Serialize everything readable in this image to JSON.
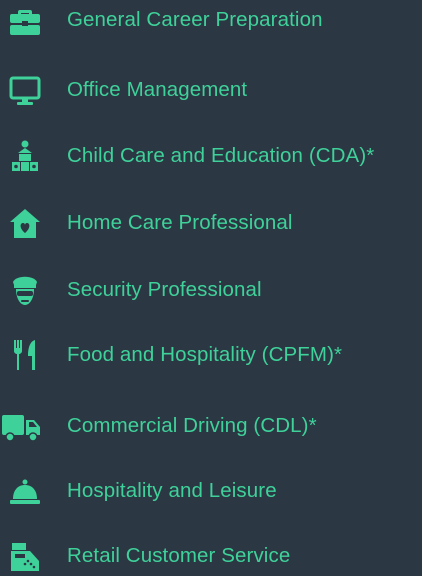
{
  "accent_color": "#3fd19a",
  "background_color": "#2b3843",
  "programs": [
    {
      "label": "General Career Preparation",
      "icon": "briefcase-icon"
    },
    {
      "label": "Office Management",
      "icon": "desktop-monitor-icon"
    },
    {
      "label": "Child Care and Education (CDA)*",
      "icon": "child-blocks-icon"
    },
    {
      "label": "Home Care Professional",
      "icon": "home-heart-icon"
    },
    {
      "label": "Security Professional",
      "icon": "security-guard-icon"
    },
    {
      "label": "Food and Hospitality (CPFM)*",
      "icon": "fork-knife-icon"
    },
    {
      "label": "Commercial Driving (CDL)*",
      "icon": "truck-icon"
    },
    {
      "label": "Hospitality and Leisure",
      "icon": "service-bell-icon"
    },
    {
      "label": "Retail Customer Service",
      "icon": "cash-register-icon"
    }
  ]
}
